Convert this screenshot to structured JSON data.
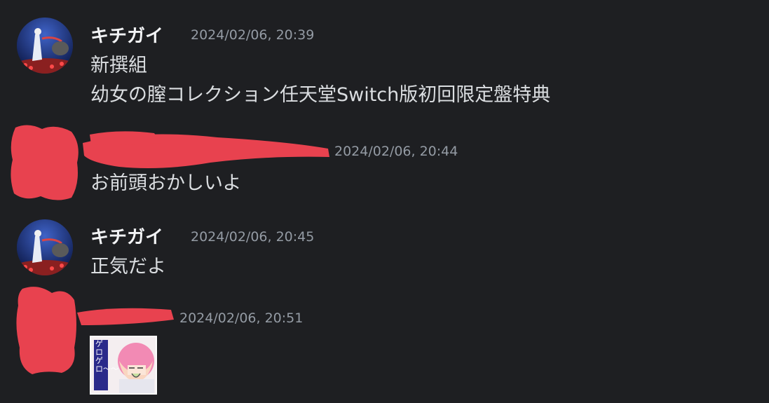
{
  "messages": [
    {
      "author": "キチガイ",
      "timestamp": "2024/02/06, 20:39",
      "lines": [
        "新撰組",
        "幼女の膣コレクション任天堂Switch版初回限定盤特典"
      ]
    },
    {
      "author": "",
      "timestamp": "2024/02/06, 20:44",
      "lines": [
        "お前頭おかしいよ"
      ]
    },
    {
      "author": "キチガイ",
      "timestamp": "2024/02/06, 20:45",
      "lines": [
        "正気だよ"
      ]
    },
    {
      "author": "",
      "timestamp": "2024/02/06, 20:51",
      "attachment": {
        "caption": "ゲロゲロ〜〜"
      }
    }
  ],
  "colors": {
    "background": "#1e1f22",
    "text": "#dbdee1",
    "timestamp": "#949ba4",
    "redaction": "#e8424f"
  },
  "icons": [
    "user-avatar-icon",
    "redaction-mark"
  ]
}
